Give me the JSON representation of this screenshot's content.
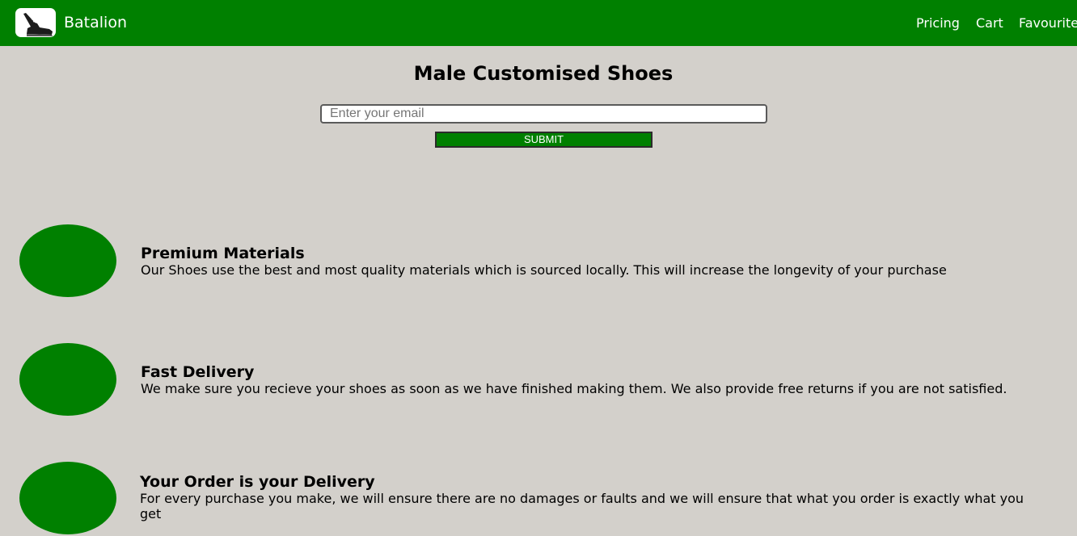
{
  "header": {
    "brand": "Batalion",
    "logo_icon": "shoe-icon",
    "nav": [
      {
        "label": "Pricing"
      },
      {
        "label": "Cart"
      },
      {
        "label": "Favourites"
      }
    ]
  },
  "main": {
    "title": "Male Customised Shoes",
    "email_placeholder": "Enter your email",
    "submit_label": "SUBMIT"
  },
  "features": [
    {
      "title": "Premium Materials",
      "description": "Our Shoes use the best and most quality materials which is sourced locally. This will increase the longevity of your purchase"
    },
    {
      "title": "Fast Delivery",
      "description": "We make sure you recieve your shoes as soon as we have finished making them. We also provide free returns if you are not satisfied."
    },
    {
      "title": "Your Order is your Delivery",
      "description": "For every purchase you make, we will ensure there are no damages or faults and we will ensure that what you order is exactly what you get"
    }
  ],
  "colors": {
    "accent": "#008000",
    "background": "#d3d0cb",
    "nav_text": "#ffffff"
  }
}
